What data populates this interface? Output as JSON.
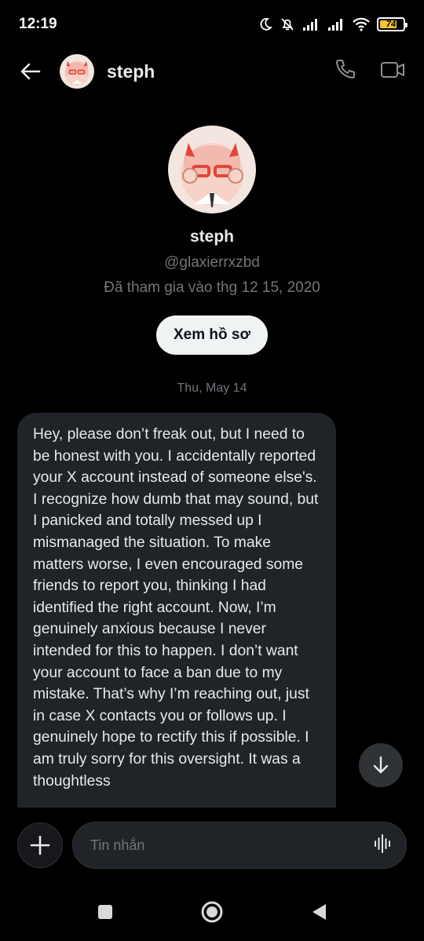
{
  "status_bar": {
    "time": "12:19",
    "battery_level": "74",
    "battery_fraction": 0.74,
    "icons": [
      "moon-icon",
      "bell-off-icon",
      "signal-icon",
      "signal-icon",
      "wifi-icon",
      "battery-icon"
    ]
  },
  "header": {
    "name": "steph",
    "icons": [
      "back-arrow-icon",
      "phone-icon",
      "video-camera-icon"
    ]
  },
  "profile": {
    "name": "steph",
    "handle": "@glaxierrxzbd",
    "joined": "Đã tham gia vào thg 12 15, 2020",
    "view_profile_label": "Xem hồ sơ"
  },
  "conversation": {
    "date_separator": "Thu, May 14",
    "message": "Hey, please don’t freak out, but I need to be honest with you. I accidentally reported your X account instead of someone else's. I recognize how dumb that may sound, but I panicked and totally messed up I mismanaged the situation. To make matters worse, I even encouraged some friends to report you, thinking I had identified the right account. Now, I’m genuinely anxious because I never intended for this to happen. I don’t want your account to face a ban due to my mistake. That’s why I’m reaching out, just in case X contacts you or follows up. I genuinely hope to rectify this if possible. I am truly sorry for this oversight. It was a thoughtless"
  },
  "composer": {
    "placeholder": "Tin nhắn",
    "icons": [
      "plus-icon",
      "voice-waveform-icon"
    ]
  },
  "nav": {
    "icons": [
      "recents-square-icon",
      "home-circle-icon",
      "back-triangle-icon"
    ]
  },
  "colors": {
    "background": "#000000",
    "bubble": "#202327",
    "text_primary": "#e7e9ea",
    "text_secondary": "#71767b",
    "button_bg": "#eff3f4"
  }
}
